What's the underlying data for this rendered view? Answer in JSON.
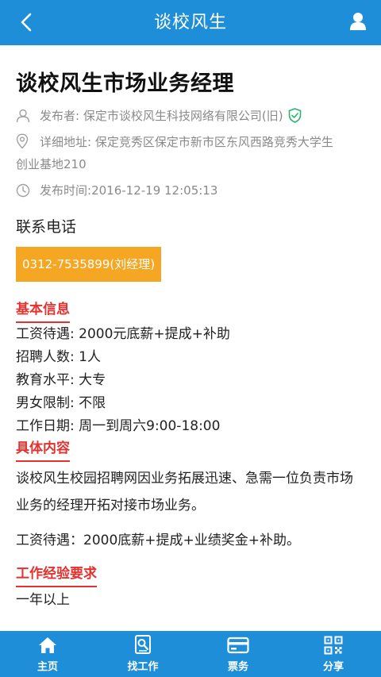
{
  "header": {
    "title": "谈校风生",
    "back_icon": "chevron-left-icon",
    "user_icon": "user-icon"
  },
  "job": {
    "title": "谈校风生市场业务经理",
    "publisher_label": "发布者:",
    "publisher": "保定市谈校风生科技网络有限公司(旧)",
    "address_label": "详细地址:",
    "address_line1": "保定竞秀区保定市新市区东风西路竞秀大学生",
    "address_line2": "创业基地210",
    "time_label": "发布时间:",
    "time": "2016-12-19 12:05:13",
    "contact_label": "联系电话",
    "phone": "0312-7535899(刘经理)"
  },
  "basic_info": {
    "title": "基本信息",
    "rows": [
      "工资待遇: 2000元底薪+提成+补助",
      "招聘人数: 1人",
      "教育水平: 大专",
      "男女限制: 不限",
      "工作日期: 周一到周六9:00-18:00"
    ]
  },
  "details": {
    "title": "具体内容",
    "paragraph1": "谈校风生校园招聘网因业务拓展迅速、急需一位负责市场业务的经理开拓对接市场业务。",
    "paragraph2": "工资待遇：2000底薪+提成+业绩奖金+补助。"
  },
  "experience": {
    "title": "工作经验要求",
    "value": "一年以上"
  },
  "tabbar": {
    "items": [
      {
        "label": "主页",
        "icon": "home-icon"
      },
      {
        "label": "找工作",
        "icon": "job-search-icon"
      },
      {
        "label": "票务",
        "icon": "ticket-card-icon"
      },
      {
        "label": "分享",
        "icon": "qr-code-icon"
      }
    ]
  },
  "colors": {
    "brand_blue": "#1f8ed8",
    "accent_orange": "#f5a623",
    "section_red": "#e3322f",
    "verified_green": "#2bb673"
  }
}
